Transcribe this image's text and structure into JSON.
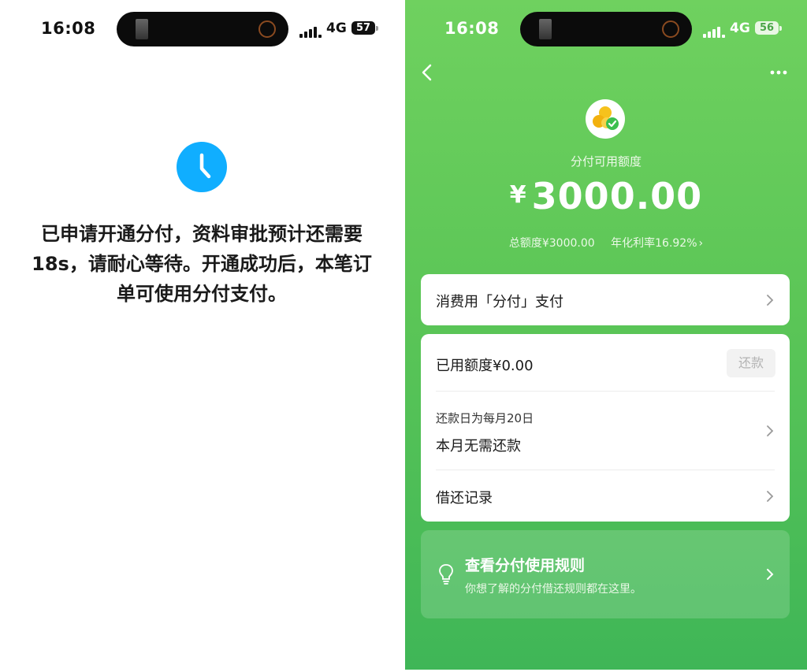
{
  "colors": {
    "wechat_green": "#5cc657",
    "clock_blue": "#10aeff"
  },
  "left": {
    "status": {
      "time": "16:08",
      "network": "4G",
      "battery": "57"
    },
    "icon": "clock-icon",
    "message": "已申请开通分付，资料审批预计还需要18s，请耐心等待。开通成功后，本笔订单可使用分付支付。"
  },
  "right": {
    "status": {
      "time": "16:08",
      "network": "4G",
      "battery": "56"
    },
    "icons": {
      "back": "chevron-left-icon",
      "more": "more-dots-icon",
      "logo": "fenfu-logo-icon"
    },
    "quota_label": "分付可用额度",
    "currency": "¥",
    "amount": "3000.00",
    "total_limit": "总额度¥3000.00",
    "annual_rate": "年化利率16.92%",
    "pay_with": "消费用「分付」支付",
    "used_amount": "已用额度¥0.00",
    "repay_button": "还款",
    "repay_day": "还款日为每月20日",
    "no_repay": "本月无需还款",
    "records": "借还记录",
    "rules_title": "查看分付使用规则",
    "rules_sub": "你想了解的分付借还规则都在这里。"
  }
}
